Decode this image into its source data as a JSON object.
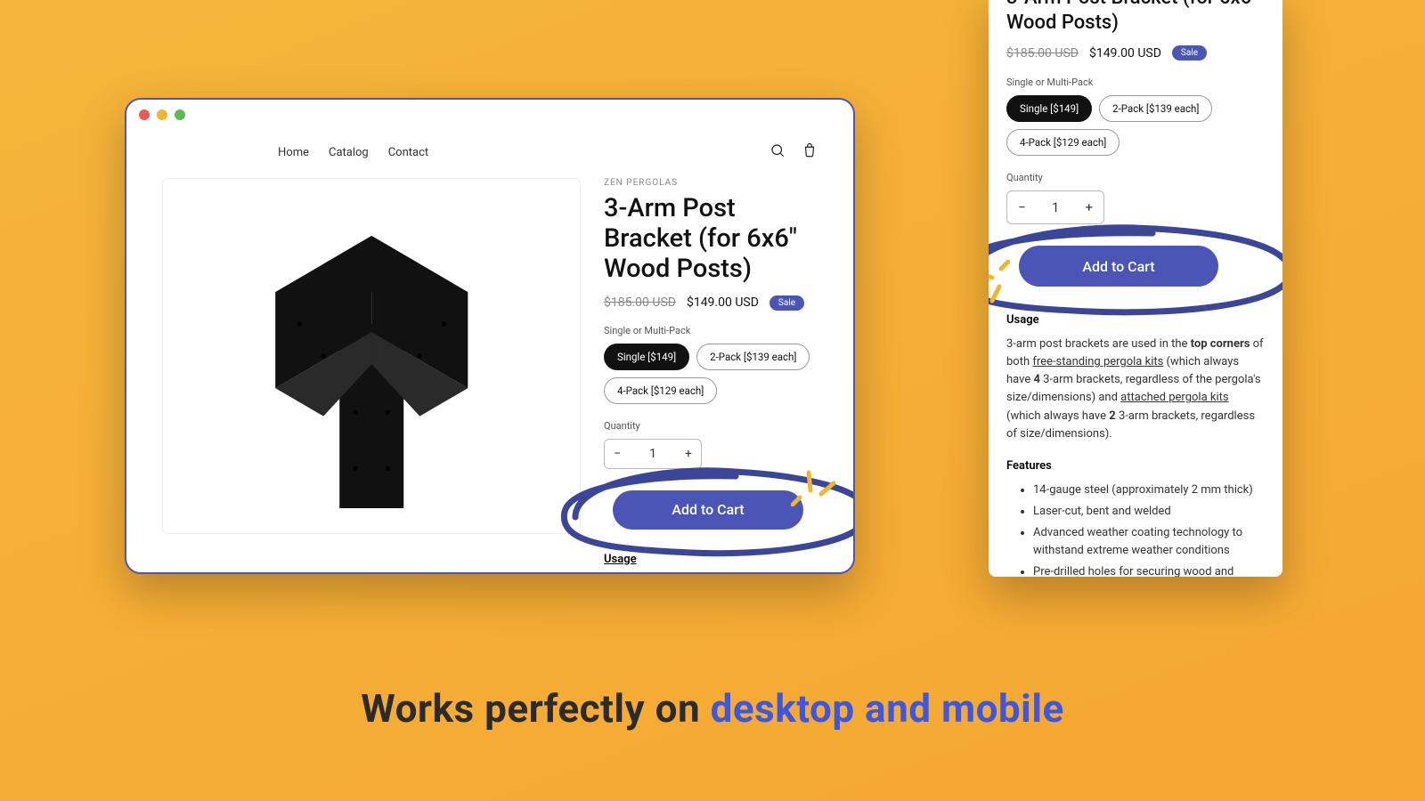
{
  "tagline": {
    "lead": "Works perfectly on ",
    "highlight": "desktop and mobile"
  },
  "nav": {
    "home": "Home",
    "catalog": "Catalog",
    "contact": "Contact"
  },
  "product": {
    "vendor": "ZEN PERGOLAS",
    "title": "3-Arm Post Bracket (for 6x6\" Wood Posts)",
    "price_old": "$185.00 USD",
    "price_new": "$149.00 USD",
    "sale_label": "Sale",
    "variant_label": "Single or Multi-Pack",
    "variants": {
      "v0": "Single [$149]",
      "v1": "2-Pack [$139 each]",
      "v2": "4-Pack [$129 each]"
    },
    "qty_label": "Quantity",
    "qty_value": "1",
    "atc_label": "Add to Cart",
    "usage_h": "Usage",
    "usage_lead": "3-arm post brackets are used in the ",
    "usage_bold": "top corners",
    "usage_mid1": " of both ",
    "usage_link1": "free-standing pergola kits",
    "usage_mid2": " (which always have ",
    "usage_bold2": "4",
    "usage_mid3": " 3-arm brackets, regardless of the pergola's size/dimensions) and ",
    "usage_link2": "attached pergola kits",
    "usage_mid4": " (which always have ",
    "usage_bold3": "2",
    "usage_tail": " 3-arm brackets, regardless of size/dimensions).",
    "desktop_tail": " (which always",
    "features_h": "Features",
    "features": {
      "f0": "14-gauge steel (approximately 2 mm thick)",
      "f1": "Laser-cut, bent and welded",
      "f2": "Advanced weather coating technology to withstand extreme weather conditions",
      "f3": "Pre-drilled holes for securing wood and accessories to bracket"
    }
  }
}
